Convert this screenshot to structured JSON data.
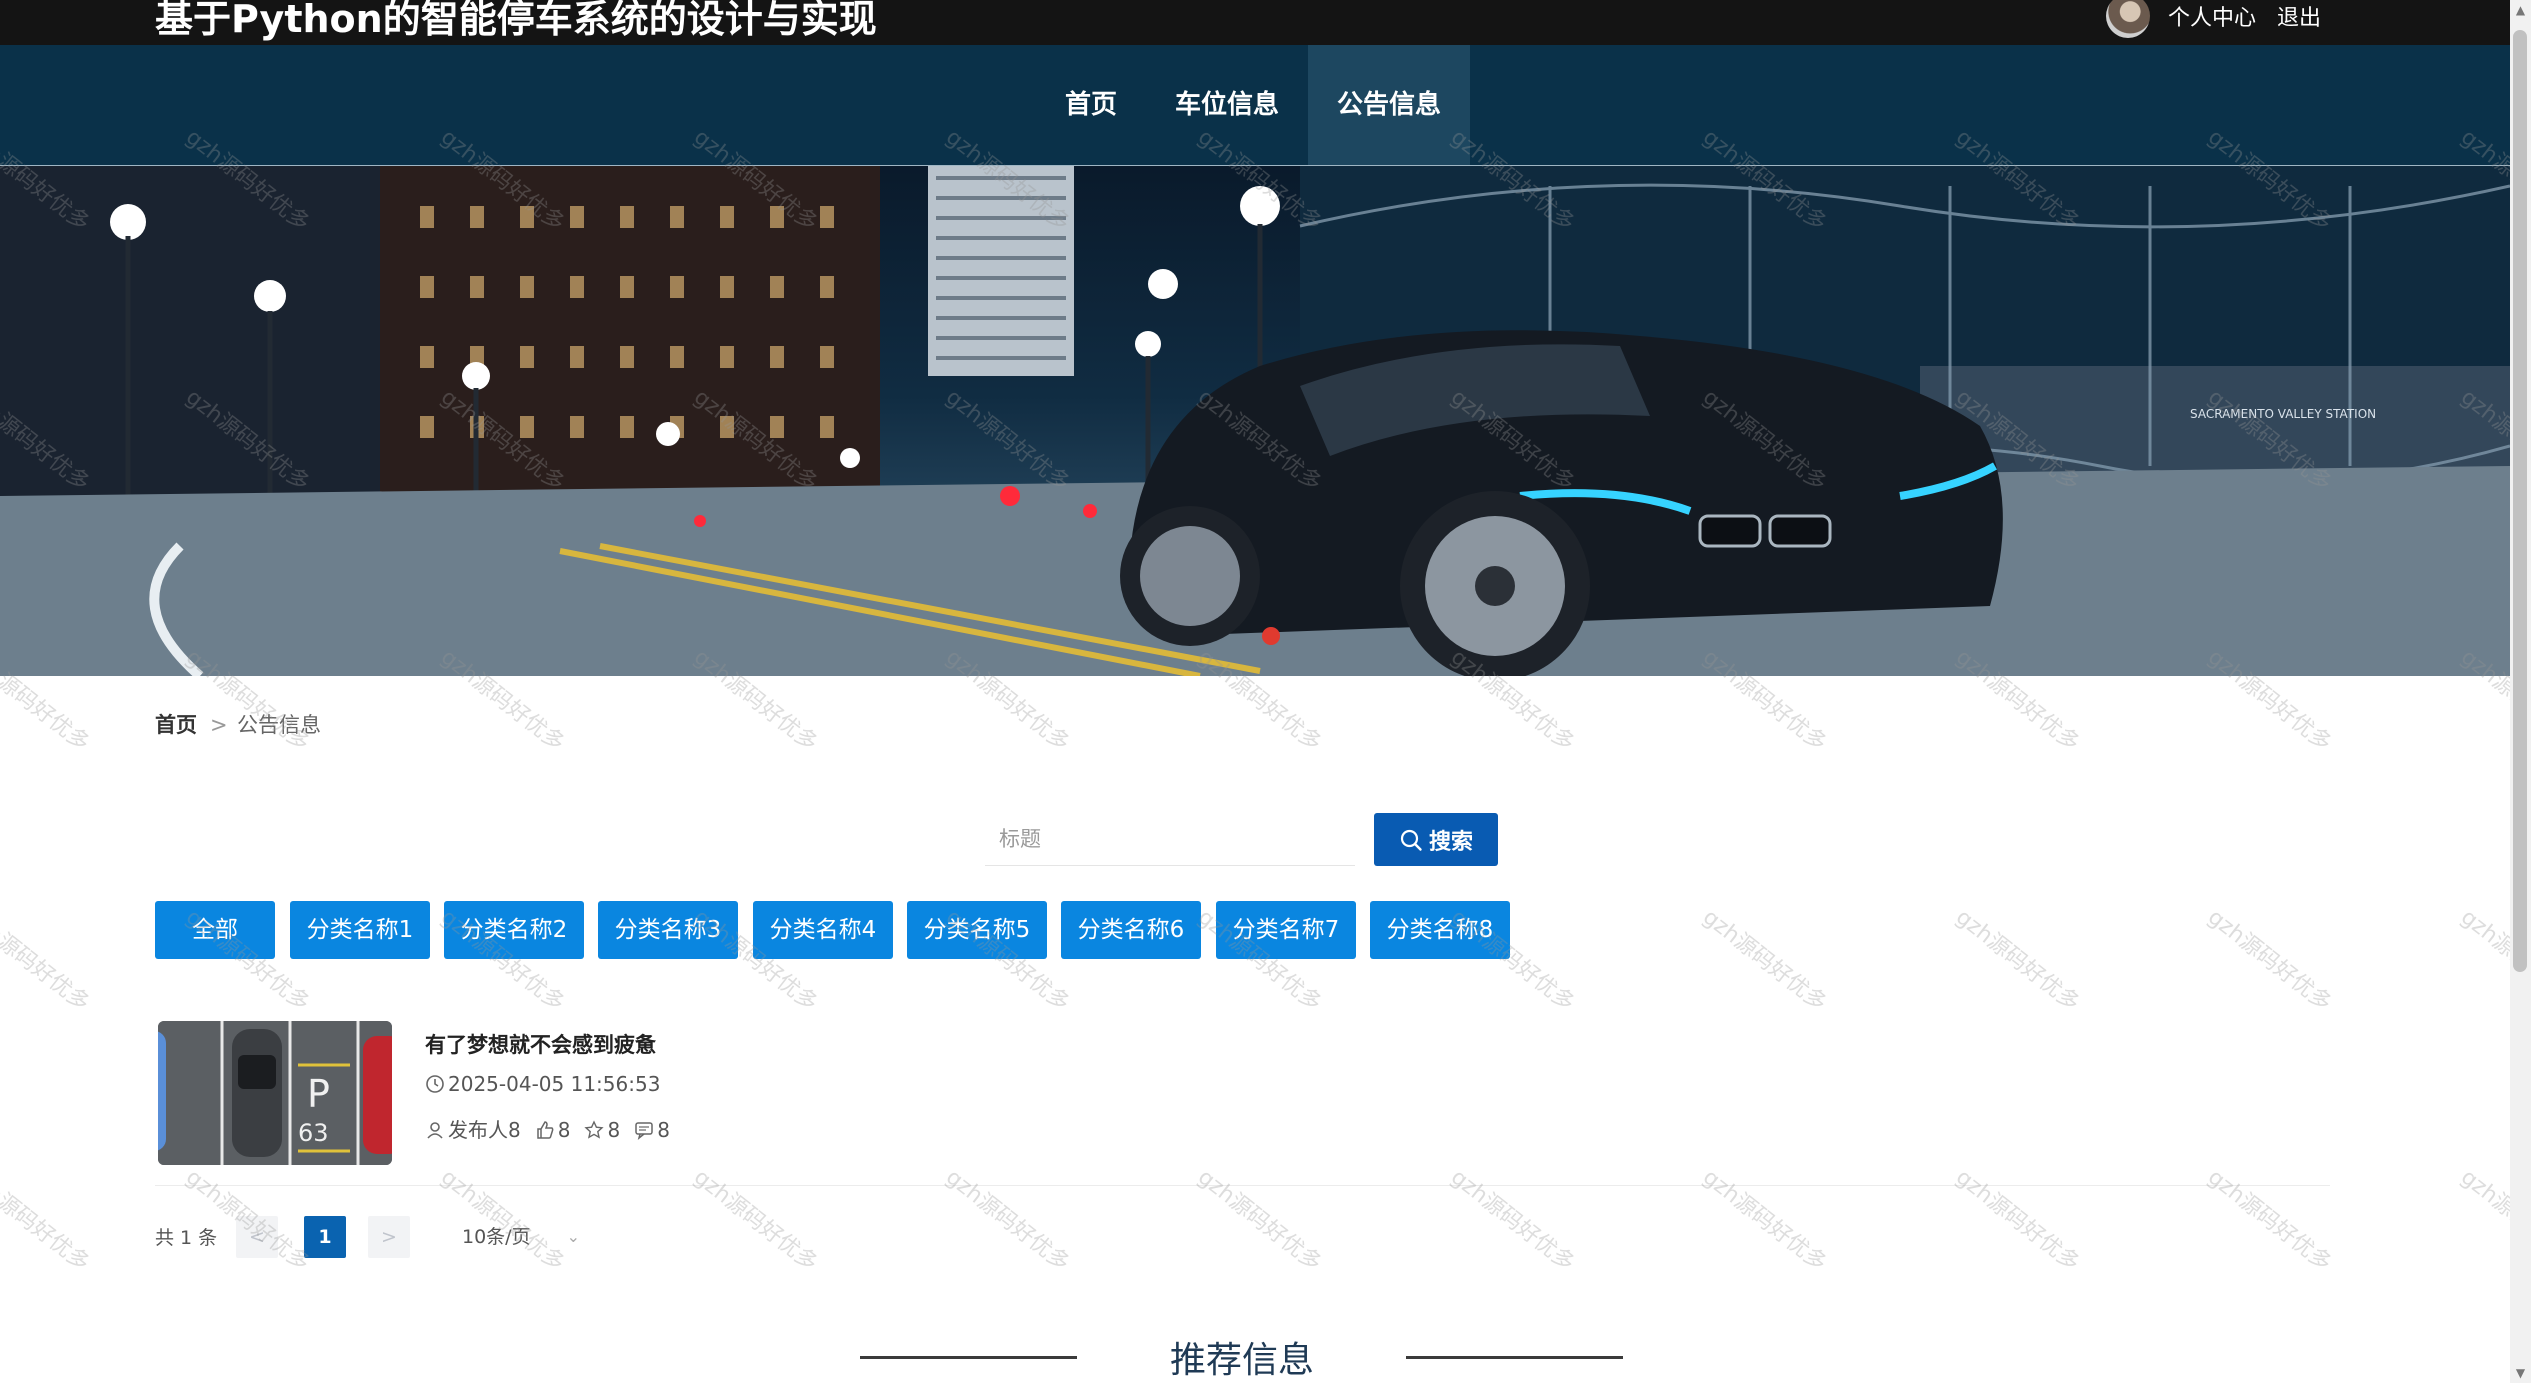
{
  "header": {
    "site_title": "基于Python的智能停车系统的设计与实现",
    "profile_label": "个人中心",
    "logout_label": "退出"
  },
  "nav": {
    "items": [
      {
        "label": "首页",
        "active": false
      },
      {
        "label": "车位信息",
        "active": false
      },
      {
        "label": "公告信息",
        "active": true
      }
    ]
  },
  "banner": {
    "sign_text": "SACRAMENTO VALLEY STATION",
    "carousel_dots": 1,
    "active_dot": 1
  },
  "breadcrumb": {
    "home": "首页",
    "separator": ">",
    "current": "公告信息"
  },
  "search": {
    "placeholder": "标题",
    "value": "",
    "button_label": "搜索"
  },
  "categories": [
    "全部",
    "分类名称1",
    "分类名称2",
    "分类名称3",
    "分类名称4",
    "分类名称5",
    "分类名称6",
    "分类名称7",
    "分类名称8"
  ],
  "list": {
    "items": [
      {
        "title": "有了梦想就不会感到疲惫",
        "datetime": "2025-04-05 11:56:53",
        "author": "发布人8",
        "likes": "8",
        "favorites": "8",
        "comments": "8",
        "thumb_sign": "P",
        "thumb_number": "63"
      }
    ]
  },
  "pagination": {
    "total": "共 1 条",
    "prev": "<",
    "current_page": "1",
    "next": ">",
    "page_size": "10条/页"
  },
  "section": {
    "title": "推荐信息"
  },
  "watermark": {
    "text": "gzh源码好优多"
  },
  "colors": {
    "topbar": "#141414",
    "navbar": "#0a3149",
    "nav_active": "#1d4760",
    "accent": "#0a86e0",
    "search_button": "#095bb2",
    "page_current": "#0a63b0",
    "carousel_dot": "#e03a2f"
  },
  "icons": {
    "search": "search-icon",
    "clock": "clock-icon",
    "user": "user-icon",
    "like": "thumbs-up-icon",
    "favorite": "star-icon",
    "comment": "comment-icon",
    "dropdown": "chevron-down-icon"
  }
}
